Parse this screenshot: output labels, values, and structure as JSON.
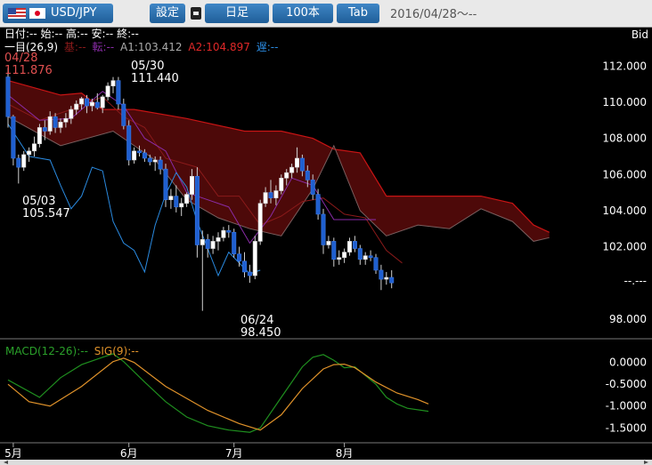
{
  "toolbar": {
    "pair": "USD/JPY",
    "settings": "設定",
    "timeframe": "日足",
    "count": "100本",
    "tab": "Tab",
    "date_range": "2016/04/28～--"
  },
  "info": {
    "ohlc": "日付:-- 始:-- 高:-- 安:-- 終:--",
    "ichimoku_label": "一目(26,9)",
    "base_label": "基:--",
    "conversion_label": "転:--",
    "span1_label": "A1:103.412",
    "span2_label": "A2:104.897",
    "lagging_label": "遅:--",
    "price_mode": "Bid"
  },
  "annotations": [
    {
      "date": "04/28",
      "price": "111.876"
    },
    {
      "date": "05/30",
      "price": "111.440"
    },
    {
      "date": "05/03",
      "price": "105.547"
    },
    {
      "date": "06/24",
      "price": "98.450"
    }
  ],
  "current_price_label": "--.---",
  "colors": {
    "cloud": "#5a0a0a",
    "span2_line": "#c81414",
    "span1_line": "#7a5f5f",
    "base_line": "#8a1a1a",
    "conversion_line": "#8a2ca8",
    "lagging_line": "#2a8ae0",
    "macd": "#1f8f1f",
    "signal": "#e0922a",
    "axis_text": "#ffffff"
  },
  "chart_data": {
    "type": "candlestick",
    "price_axis": {
      "ticks": [
        "112.000",
        "110.000",
        "108.000",
        "106.000",
        "104.000",
        "102.000",
        "98.000"
      ],
      "ylim": [
        97.2,
        113.2
      ]
    },
    "macd_axis": {
      "ticks": [
        "0.0000",
        "-0.5000",
        "-1.0000",
        "-1.5000"
      ],
      "ylim": [
        -1.78,
        0.36
      ]
    },
    "x_labels": [
      {
        "label": "5月",
        "i": 1
      },
      {
        "label": "6月",
        "i": 23
      },
      {
        "label": "7月",
        "i": 43
      },
      {
        "label": "8月",
        "i": 64
      }
    ],
    "candles": [
      [
        111.4,
        111.9,
        108.6,
        109.2
      ],
      [
        109.2,
        109.3,
        106.5,
        106.9
      ],
      [
        106.9,
        107.1,
        105.5,
        106.4
      ],
      [
        106.4,
        107.3,
        106.2,
        107.1
      ],
      [
        107.1,
        107.5,
        106.7,
        107.3
      ],
      [
        107.3,
        108.1,
        107.0,
        107.7
      ],
      [
        107.7,
        108.8,
        107.5,
        108.6
      ],
      [
        108.6,
        109.0,
        107.9,
        108.4
      ],
      [
        108.4,
        109.5,
        108.2,
        109.2
      ],
      [
        109.2,
        109.4,
        108.3,
        108.6
      ],
      [
        108.6,
        109.1,
        108.3,
        108.9
      ],
      [
        108.9,
        109.4,
        108.6,
        109.1
      ],
      [
        109.1,
        109.8,
        108.8,
        109.6
      ],
      [
        109.6,
        110.1,
        109.3,
        109.9
      ],
      [
        109.9,
        110.3,
        109.6,
        110.2
      ],
      [
        110.2,
        110.4,
        109.4,
        109.8
      ],
      [
        109.8,
        110.2,
        109.5,
        110.0
      ],
      [
        110.0,
        110.5,
        109.6,
        109.7
      ],
      [
        109.7,
        110.4,
        109.4,
        110.3
      ],
      [
        110.3,
        111.1,
        110.1,
        110.9
      ],
      [
        110.9,
        111.4,
        110.5,
        111.2
      ],
      [
        111.2,
        111.4,
        109.6,
        109.9
      ],
      [
        109.9,
        110.2,
        108.5,
        108.7
      ],
      [
        108.7,
        109.0,
        106.5,
        106.8
      ],
      [
        106.8,
        107.5,
        106.6,
        107.3
      ],
      [
        107.3,
        107.6,
        107.0,
        107.2
      ],
      [
        107.2,
        107.4,
        106.7,
        106.9
      ],
      [
        106.9,
        107.1,
        106.5,
        106.7
      ],
      [
        106.7,
        107.0,
        106.2,
        106.8
      ],
      [
        106.8,
        107.0,
        106.0,
        106.3
      ],
      [
        106.3,
        106.6,
        104.2,
        104.6
      ],
      [
        104.6,
        105.2,
        104.1,
        104.8
      ],
      [
        104.8,
        105.4,
        103.9,
        104.2
      ],
      [
        104.2,
        104.7,
        103.7,
        104.4
      ],
      [
        104.4,
        105.0,
        104.2,
        104.9
      ],
      [
        104.9,
        106.3,
        104.6,
        105.9
      ],
      [
        105.9,
        106.4,
        101.4,
        102.1
      ],
      [
        102.1,
        102.9,
        98.45,
        102.4
      ],
      [
        102.4,
        102.7,
        101.4,
        101.9
      ],
      [
        101.9,
        102.6,
        101.6,
        102.3
      ],
      [
        102.3,
        102.8,
        101.8,
        102.5
      ],
      [
        102.5,
        103.1,
        102.3,
        102.9
      ],
      [
        102.9,
        103.2,
        102.5,
        102.8
      ],
      [
        102.8,
        103.0,
        101.4,
        101.6
      ],
      [
        101.6,
        102.0,
        100.9,
        101.2
      ],
      [
        101.2,
        101.7,
        100.3,
        100.6
      ],
      [
        100.6,
        101.0,
        100.0,
        100.4
      ],
      [
        100.4,
        102.6,
        100.2,
        102.3
      ],
      [
        102.3,
        104.6,
        102.1,
        104.4
      ],
      [
        104.4,
        105.3,
        104.2,
        105.0
      ],
      [
        105.0,
        105.7,
        104.4,
        104.7
      ],
      [
        104.7,
        105.4,
        104.3,
        105.1
      ],
      [
        105.1,
        106.0,
        104.9,
        105.8
      ],
      [
        105.8,
        106.3,
        105.4,
        106.1
      ],
      [
        106.1,
        106.6,
        105.8,
        106.4
      ],
      [
        106.4,
        107.5,
        106.1,
        106.9
      ],
      [
        106.9,
        107.1,
        105.9,
        106.2
      ],
      [
        106.2,
        106.5,
        105.3,
        105.7
      ],
      [
        105.7,
        106.0,
        104.6,
        104.9
      ],
      [
        104.9,
        105.2,
        103.5,
        103.8
      ],
      [
        103.8,
        104.1,
        101.6,
        102.1
      ],
      [
        102.1,
        102.6,
        101.9,
        102.3
      ],
      [
        102.3,
        102.5,
        100.9,
        101.3
      ],
      [
        101.3,
        101.8,
        101.0,
        101.4
      ],
      [
        101.4,
        101.9,
        101.1,
        101.7
      ],
      [
        101.7,
        102.5,
        101.5,
        102.3
      ],
      [
        102.3,
        102.6,
        101.7,
        101.9
      ],
      [
        101.9,
        102.1,
        101.0,
        101.3
      ],
      [
        101.3,
        101.7,
        101.0,
        101.5
      ],
      [
        101.5,
        101.8,
        101.2,
        101.4
      ],
      [
        101.4,
        101.6,
        100.5,
        100.7
      ],
      [
        100.7,
        101.0,
        99.6,
        100.2
      ],
      [
        100.2,
        100.6,
        99.9,
        100.3
      ],
      [
        100.3,
        100.7,
        99.7,
        100.0
      ]
    ],
    "span_a": [
      [
        0,
        109.2
      ],
      [
        10,
        107.6
      ],
      [
        20,
        108.4
      ],
      [
        22,
        108.0
      ],
      [
        28,
        106.8
      ],
      [
        34,
        104.6
      ],
      [
        40,
        103.6
      ],
      [
        46,
        103.0
      ],
      [
        52,
        102.6
      ],
      [
        58,
        105.2
      ],
      [
        62,
        107.6
      ],
      [
        67,
        104.0
      ],
      [
        72,
        102.6
      ],
      [
        78,
        103.2
      ],
      [
        84,
        103.0
      ],
      [
        90,
        104.1
      ],
      [
        96,
        103.4
      ],
      [
        100,
        102.3
      ],
      [
        103,
        102.5
      ]
    ],
    "span_b": [
      [
        0,
        111.2
      ],
      [
        10,
        110.4
      ],
      [
        14,
        110.5
      ],
      [
        18,
        109.6
      ],
      [
        24,
        109.6
      ],
      [
        34,
        109.1
      ],
      [
        45,
        108.4
      ],
      [
        52,
        108.4
      ],
      [
        58,
        108.0
      ],
      [
        62,
        107.4
      ],
      [
        67,
        107.2
      ],
      [
        72,
        104.8
      ],
      [
        90,
        104.8
      ],
      [
        96,
        104.4
      ],
      [
        100,
        103.2
      ],
      [
        103,
        102.8
      ]
    ],
    "base_line": [
      [
        0,
        109.9
      ],
      [
        6,
        109.0
      ],
      [
        12,
        109.6
      ],
      [
        18,
        110.3
      ],
      [
        22,
        109.2
      ],
      [
        26,
        108.6
      ],
      [
        30,
        106.9
      ],
      [
        36,
        106.4
      ],
      [
        40,
        104.8
      ],
      [
        44,
        104.8
      ],
      [
        48,
        103.2
      ],
      [
        52,
        103.7
      ],
      [
        56,
        104.5
      ],
      [
        60,
        104.7
      ],
      [
        64,
        103.8
      ],
      [
        68,
        103.6
      ],
      [
        72,
        101.8
      ],
      [
        75,
        101.1
      ]
    ],
    "conversion_line": [
      [
        0,
        110.4
      ],
      [
        6,
        109.0
      ],
      [
        12,
        109.1
      ],
      [
        18,
        110.6
      ],
      [
        22,
        109.8
      ],
      [
        26,
        108.0
      ],
      [
        30,
        107.3
      ],
      [
        34,
        105.0
      ],
      [
        38,
        104.6
      ],
      [
        42,
        104.2
      ],
      [
        46,
        102.2
      ],
      [
        50,
        103.7
      ],
      [
        54,
        105.8
      ],
      [
        58,
        105.4
      ],
      [
        62,
        103.5
      ],
      [
        66,
        103.5
      ],
      [
        70,
        103.5
      ]
    ],
    "lagging_line": [
      [
        0,
        108.8
      ],
      [
        4,
        107.0
      ],
      [
        8,
        106.8
      ],
      [
        10,
        105.4
      ],
      [
        12,
        104.1
      ],
      [
        14,
        104.8
      ],
      [
        16,
        106.4
      ],
      [
        18,
        106.2
      ],
      [
        20,
        103.4
      ],
      [
        22,
        102.2
      ],
      [
        24,
        101.8
      ],
      [
        26,
        100.6
      ],
      [
        28,
        103.2
      ],
      [
        30,
        104.9
      ],
      [
        32,
        106.1
      ],
      [
        34,
        105.3
      ],
      [
        36,
        103.4
      ],
      [
        38,
        101.9
      ],
      [
        40,
        100.4
      ],
      [
        42,
        101.7
      ],
      [
        44,
        101.1
      ],
      [
        46,
        100.5
      ],
      [
        48,
        100.7
      ]
    ],
    "macd": [
      [
        0,
        -0.4
      ],
      [
        6,
        -0.8
      ],
      [
        10,
        -0.35
      ],
      [
        14,
        -0.05
      ],
      [
        18,
        0.12
      ],
      [
        20,
        0.2
      ],
      [
        22,
        0.02
      ],
      [
        26,
        -0.45
      ],
      [
        30,
        -0.9
      ],
      [
        34,
        -1.25
      ],
      [
        38,
        -1.45
      ],
      [
        42,
        -1.55
      ],
      [
        46,
        -1.6
      ],
      [
        48,
        -1.5
      ],
      [
        52,
        -0.8
      ],
      [
        56,
        -0.1
      ],
      [
        58,
        0.12
      ],
      [
        60,
        0.18
      ],
      [
        62,
        0.05
      ],
      [
        64,
        -0.12
      ],
      [
        66,
        -0.1
      ],
      [
        70,
        -0.5
      ],
      [
        72,
        -0.8
      ],
      [
        74,
        -0.95
      ],
      [
        76,
        -1.05
      ],
      [
        80,
        -1.12
      ]
    ],
    "signal": [
      [
        0,
        -0.5
      ],
      [
        4,
        -0.9
      ],
      [
        8,
        -1.0
      ],
      [
        14,
        -0.55
      ],
      [
        20,
        0.02
      ],
      [
        22,
        0.1
      ],
      [
        24,
        0.0
      ],
      [
        30,
        -0.55
      ],
      [
        38,
        -1.1
      ],
      [
        44,
        -1.4
      ],
      [
        48,
        -1.55
      ],
      [
        52,
        -1.2
      ],
      [
        56,
        -0.6
      ],
      [
        60,
        -0.15
      ],
      [
        62,
        -0.05
      ],
      [
        64,
        -0.04
      ],
      [
        66,
        -0.12
      ],
      [
        70,
        -0.45
      ],
      [
        74,
        -0.7
      ],
      [
        78,
        -0.85
      ],
      [
        80,
        -0.95
      ]
    ]
  }
}
